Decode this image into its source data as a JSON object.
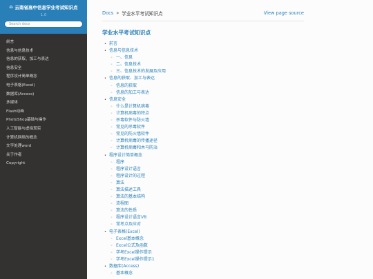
{
  "sidebar": {
    "title": "云南省高中信息学业考试知识点",
    "version": "1.0",
    "search_placeholder": "Search docs",
    "items": [
      "前言",
      "信息与信息技术",
      "信息的获取、加工与表达",
      "信息安全",
      "程序设计简单概念",
      "电子表格(Excel)",
      "数据库(Access)",
      "多媒体",
      "Flash动画",
      "PhotoShop基础与操作",
      "人工智能与虚拟现实",
      "计算机网络的概念",
      "文字处理word",
      "关于作者",
      "Copyright"
    ]
  },
  "breadcrumbs": {
    "docs": "Docs",
    "separator": "»",
    "current": "学业水平考试知识点",
    "view_source": "View page source"
  },
  "page": {
    "title": "学业水平考试知识点"
  },
  "toc": [
    {
      "level": 1,
      "text": "前言"
    },
    {
      "level": 1,
      "text": "信息与信息技术"
    },
    {
      "level": 2,
      "text": "一、信息"
    },
    {
      "level": 2,
      "text": "二、信息技术"
    },
    {
      "level": 2,
      "text": "三、信息技术的发展及应用"
    },
    {
      "level": 1,
      "text": "信息的获取、加工与表达"
    },
    {
      "level": 2,
      "text": "信息的获取"
    },
    {
      "level": 2,
      "text": "信息的加工与表达"
    },
    {
      "level": 1,
      "text": "信息安全"
    },
    {
      "level": 2,
      "text": "什么是计算机病毒"
    },
    {
      "level": 2,
      "text": "计算机病毒的特点"
    },
    {
      "level": 2,
      "text": "杀毒软件与防火墙"
    },
    {
      "level": 2,
      "text": "常见的杀毒软件"
    },
    {
      "level": 2,
      "text": "常见的防火墙软件"
    },
    {
      "level": 2,
      "text": "计算机病毒的传播途径"
    },
    {
      "level": 2,
      "text": "计算机病毒和木马防治"
    },
    {
      "level": 1,
      "text": "程序设计简单概念"
    },
    {
      "level": 2,
      "text": "程序"
    },
    {
      "level": 2,
      "text": "程序设计语言"
    },
    {
      "level": 2,
      "text": "程序设计的过程"
    },
    {
      "level": 2,
      "text": "算法"
    },
    {
      "level": 2,
      "text": "算法描述工具"
    },
    {
      "level": 2,
      "text": "算法的基本结构"
    },
    {
      "level": 2,
      "text": "流程图"
    },
    {
      "level": 2,
      "text": "算法的性质"
    },
    {
      "level": 2,
      "text": "程序设计语言VB"
    },
    {
      "level": 2,
      "text": "常考点及应对"
    },
    {
      "level": 1,
      "text": "电子表格(Excel)"
    },
    {
      "level": 2,
      "text": "Excel基本概念"
    },
    {
      "level": 2,
      "text": "Excel公式及函数"
    },
    {
      "level": 2,
      "text": "学考Excel操作提示"
    },
    {
      "level": 2,
      "text": "学考Excel操作提示1"
    },
    {
      "level": 1,
      "text": "数据库(Access)"
    },
    {
      "level": 2,
      "text": "基本概念"
    }
  ]
}
